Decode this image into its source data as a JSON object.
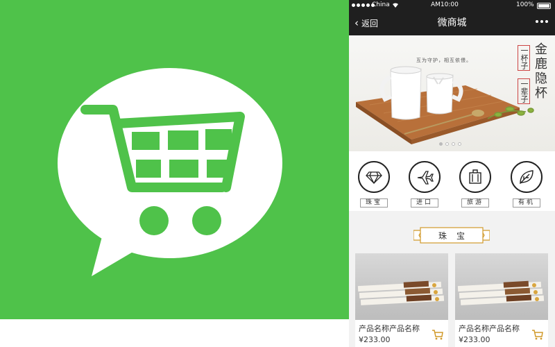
{
  "status_bar": {
    "carrier": "China",
    "time": "AM10:00",
    "battery": "100%"
  },
  "nav": {
    "back_label": "返回",
    "title": "微商城"
  },
  "banner": {
    "slogan": "互为守护，相互依偎。",
    "brand_title": "金鹿隐杯",
    "tag_one": "一杯子",
    "tag_two": "一辈子",
    "slide_count": 4,
    "active_slide": 1
  },
  "categories": [
    {
      "label": "珠宝",
      "icon": "diamond-icon"
    },
    {
      "label": "进口",
      "icon": "airplane-icon"
    },
    {
      "label": "旅游",
      "icon": "luggage-icon"
    },
    {
      "label": "有机",
      "icon": "leaf-icon"
    }
  ],
  "section": {
    "title": "珠宝"
  },
  "products": [
    {
      "name": "产品名称产品名称",
      "price": "¥233.00"
    },
    {
      "name": "产品名称产品名称",
      "price": "¥233.00"
    }
  ],
  "colors": {
    "logo_green": "#4fc24a",
    "nav_bg": "#1f1f1f",
    "accent_gold": "#d19a2a"
  }
}
